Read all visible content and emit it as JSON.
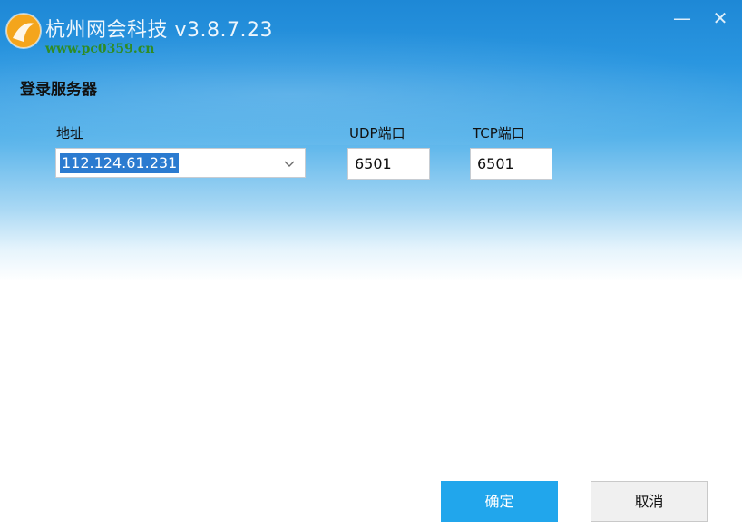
{
  "window": {
    "title": "杭州网会科技 v3.8.7.23",
    "watermark": "www.pc0359.cn",
    "minimize_glyph": "—",
    "close_glyph": "✕"
  },
  "section": {
    "title": "登录服务器"
  },
  "form": {
    "address_label": "地址",
    "address_value": "112.124.61.231",
    "udp_label": "UDP端口",
    "udp_value": "6501",
    "tcp_label": "TCP端口",
    "tcp_value": "6501"
  },
  "buttons": {
    "ok": "确定",
    "cancel": "取消"
  },
  "colors": {
    "title_bar": "#1e88d6",
    "primary_button": "#21a6ec",
    "selection": "#2b7bd0"
  },
  "icons": [
    "app-logo-icon",
    "minimize-icon",
    "close-icon",
    "chevron-down-icon"
  ]
}
